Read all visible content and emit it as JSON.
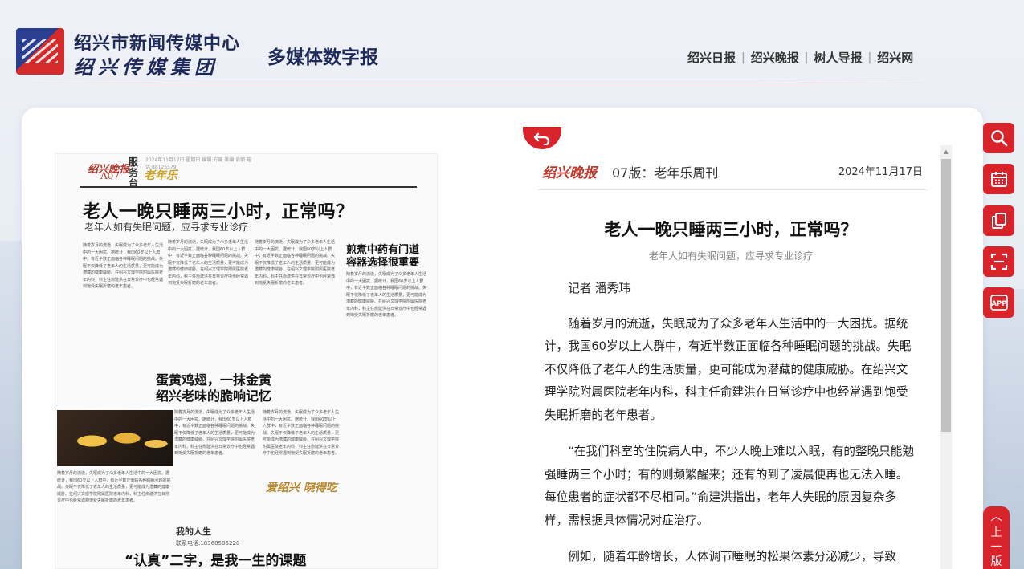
{
  "header": {
    "brand_line1": "绍兴市新闻传媒中心",
    "brand_line2": "绍兴传媒集团",
    "brand_sub": "多媒体数字报",
    "nav": [
      "绍兴日报",
      "绍兴晚报",
      "树人导报",
      "绍兴网"
    ]
  },
  "newspaper_page": {
    "masthead": "绍兴晚报",
    "page_no": "A07",
    "section": "服务台",
    "column_logo": "老年乐",
    "meta": "2024年11月17日 星期日 编辑:方瑜 美编:俞丽 电话:88125579",
    "headline": "老人一晚只睡两三小时，正常吗？",
    "subheadline": "老年人如有失眠问题，应寻求专业诊疗",
    "side_headline": "煎煮中药有门道\n容器选择很重要",
    "headline2": "蛋黄鸡翅，一抹金黄\n绍兴老味的脆响记忆",
    "stamp": "爱绍兴 晓得吃",
    "foot_logo": "我的人生",
    "contact": "联系电话:18368506220",
    "headline3": "“认真”二字，是我一生的课题",
    "filler_text": "随着岁月的流逝，失眠成为了众多老年人生活中的一大困扰。据统计，我国60岁以上人群中，有近半数正面临各种睡眠问题的挑战。失眠不仅降低了老年人的生活质量，更可能成为潜藏的健康威胁。在绍兴文理学院附属医院老年内科，科主任俞建洪在日常诊疗中也经常遇到饱受失眠折磨的老年患者。"
  },
  "article": {
    "paper_name": "绍兴晚报",
    "edition": "07版：老年乐周刊",
    "date": "2024年11月17日",
    "title": "老人一晚只睡两三小时，正常吗？",
    "subtitle": "老年人如有失眠问题，应寻求专业诊疗",
    "author": "记者 潘秀玮",
    "paragraphs": [
      "随着岁月的流逝，失眠成为了众多老年人生活中的一大困扰。据统计，我国60岁以上人群中，有近半数正面临各种睡眠问题的挑战。失眠不仅降低了老年人的生活质量，更可能成为潜藏的健康威胁。在绍兴文理学院附属医院老年内科，科主任俞建洪在日常诊疗中也经常遇到饱受失眠折磨的老年患者。",
      "“在我们科室的住院病人中，不少人晚上难以入眠，有的整晚只能勉强睡两三个小时；有的则频繁醒来；还有的到了凌晨便再也无法入睡。每位患者的症状都不尽相同。”俞建洪指出，老年人失眠的原因复杂多样，需根据具体情况对症治疗。",
      "例如，随着年龄增长，人体调节睡眠的松果体素分泌减少，导致"
    ]
  },
  "tools": [
    "search-icon",
    "calendar-icon",
    "copy-icon",
    "scan-icon",
    "app-icon"
  ],
  "to_top_label": "上一版",
  "colors": {
    "accent": "#d8232a",
    "brand_navy": "#1d2a5a"
  }
}
